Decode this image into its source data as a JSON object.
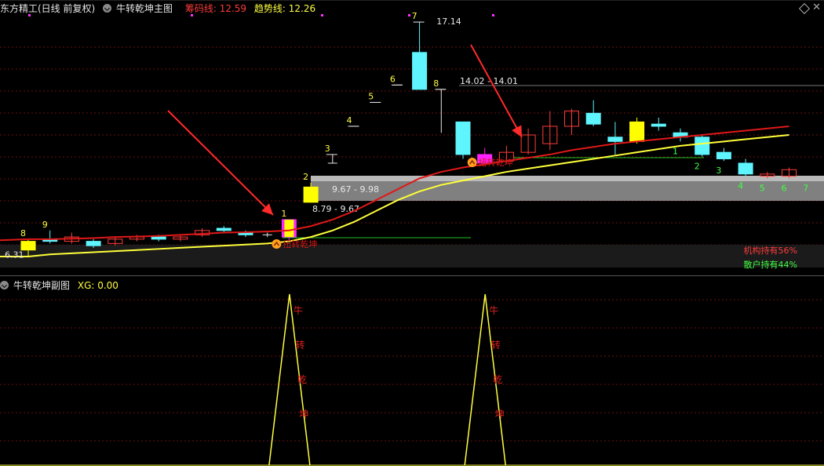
{
  "header": {
    "stock_label": "东方精工(日线 前复权)",
    "indicator_main": "牛转乾坤主图",
    "chip_line_label": "筹码线: 12.59",
    "trend_line_label": "趋势线: 12.26"
  },
  "sub_header": {
    "indicator_sub": "牛转乾坤副图",
    "xg_label": "XG: 0.00"
  },
  "annotations": {
    "price_high": "17.14",
    "price_low": "6.31",
    "range_upper": "14.02 - 14.01",
    "range_mid": "9.67 - 9.98",
    "range_low": "8.79 - 9.67",
    "signal_text": "扭转乾坤",
    "institution_hold": "机构持有56%",
    "retail_hold": "散户持有44%",
    "sub_chars": [
      "牛",
      "转",
      "乾",
      "坤"
    ]
  },
  "colors": {
    "chip_line": "#e01818",
    "trend_line": "#ffff3a",
    "up_candle": "#ff3b3b",
    "down_candle": "#5ff5ff",
    "signal_candle": "#ff22ff",
    "highlight_candle": "#ffff00"
  },
  "chart_data": {
    "type": "candlestick",
    "candles": [
      {
        "o": 7.0,
        "c": 6.6,
        "h": 7.1,
        "l": 6.3,
        "style": "yellow"
      },
      {
        "o": 7.0,
        "c": 7.1,
        "h": 7.5,
        "l": 6.9,
        "style": "down"
      },
      {
        "o": 7.0,
        "c": 7.2,
        "h": 7.4,
        "l": 6.9,
        "style": "up"
      },
      {
        "o": 7.0,
        "c": 6.8,
        "h": 7.1,
        "l": 6.7,
        "style": "down"
      },
      {
        "o": 6.9,
        "c": 7.1,
        "h": 7.2,
        "l": 6.8,
        "style": "up"
      },
      {
        "o": 7.1,
        "c": 7.2,
        "h": 7.3,
        "l": 7.0,
        "style": "up"
      },
      {
        "o": 7.2,
        "c": 7.1,
        "h": 7.3,
        "l": 7.0,
        "style": "down"
      },
      {
        "o": 7.1,
        "c": 7.2,
        "h": 7.3,
        "l": 7.0,
        "style": "up"
      },
      {
        "o": 7.3,
        "c": 7.5,
        "h": 7.6,
        "l": 7.2,
        "style": "up"
      },
      {
        "o": 7.6,
        "c": 7.5,
        "h": 7.7,
        "l": 7.4,
        "style": "down"
      },
      {
        "o": 7.4,
        "c": 7.3,
        "h": 7.5,
        "l": 7.2,
        "style": "down"
      },
      {
        "o": 7.3,
        "c": 7.3,
        "h": 7.4,
        "l": 7.2,
        "style": "flat"
      },
      {
        "o": 7.2,
        "c": 8.0,
        "h": 8.0,
        "l": 7.0,
        "style": "signal"
      },
      {
        "o": 8.8,
        "c": 9.5,
        "h": 9.7,
        "l": 8.8,
        "style": "yellow"
      },
      {
        "o": 10.6,
        "c": 10.6,
        "h": 11.0,
        "l": 10.6,
        "style": "flat"
      },
      {
        "o": 12.3,
        "c": 12.3,
        "h": 12.3,
        "l": 12.3,
        "style": "flat"
      },
      {
        "o": 13.4,
        "c": 13.4,
        "h": 13.4,
        "l": 13.4,
        "style": "flat"
      },
      {
        "o": 14.2,
        "c": 14.2,
        "h": 14.2,
        "l": 14.2,
        "style": "flat"
      },
      {
        "o": 15.7,
        "c": 14.0,
        "h": 17.1,
        "l": 14.0,
        "style": "down"
      },
      {
        "o": 14.0,
        "c": 14.0,
        "h": 14.0,
        "l": 12.0,
        "style": "flat"
      },
      {
        "o": 12.5,
        "c": 11.0,
        "h": 12.5,
        "l": 10.8,
        "style": "down"
      },
      {
        "o": 11.0,
        "c": 10.6,
        "h": 11.3,
        "l": 10.6,
        "style": "signal"
      },
      {
        "o": 10.7,
        "c": 11.1,
        "h": 11.4,
        "l": 10.6,
        "style": "up"
      },
      {
        "o": 11.1,
        "c": 11.9,
        "h": 12.2,
        "l": 11.0,
        "style": "up"
      },
      {
        "o": 11.5,
        "c": 12.3,
        "h": 13.0,
        "l": 11.2,
        "style": "up"
      },
      {
        "o": 12.3,
        "c": 13.0,
        "h": 13.1,
        "l": 11.9,
        "style": "up"
      },
      {
        "o": 12.9,
        "c": 12.4,
        "h": 13.5,
        "l": 12.3,
        "style": "down"
      },
      {
        "o": 11.8,
        "c": 11.6,
        "h": 12.5,
        "l": 11.0,
        "style": "down"
      },
      {
        "o": 11.6,
        "c": 12.5,
        "h": 12.7,
        "l": 11.5,
        "style": "yellow"
      },
      {
        "o": 12.4,
        "c": 12.3,
        "h": 12.7,
        "l": 12.1,
        "style": "down"
      },
      {
        "o": 12.0,
        "c": 11.8,
        "h": 12.2,
        "l": 11.6,
        "style": "down"
      },
      {
        "o": 11.8,
        "c": 11.0,
        "h": 11.9,
        "l": 10.9,
        "style": "down"
      },
      {
        "o": 11.1,
        "c": 10.8,
        "h": 11.3,
        "l": 10.7,
        "style": "down"
      },
      {
        "o": 10.6,
        "c": 10.1,
        "h": 10.8,
        "l": 10.0,
        "style": "down"
      },
      {
        "o": 10.1,
        "c": 10.0,
        "h": 10.2,
        "l": 9.9,
        "style": "up"
      },
      {
        "o": 10.0,
        "c": 10.3,
        "h": 10.4,
        "l": 9.9,
        "style": "up"
      }
    ],
    "chip_line": [
      7.1,
      7.1,
      7.12,
      7.15,
      7.2,
      7.22,
      7.25,
      7.3,
      7.35,
      7.4,
      7.42,
      7.45,
      7.5,
      7.7,
      8.0,
      8.4,
      8.9,
      9.4,
      9.9,
      10.2,
      10.4,
      10.55,
      10.7,
      10.85,
      11.0,
      11.2,
      11.35,
      11.5,
      11.6,
      11.7,
      11.8,
      11.9,
      12.0,
      12.1,
      12.2,
      12.3
    ],
    "trend_line": [
      6.3,
      6.4,
      6.45,
      6.5,
      6.55,
      6.6,
      6.65,
      6.7,
      6.75,
      6.8,
      6.85,
      6.9,
      7.0,
      7.2,
      7.5,
      7.9,
      8.4,
      8.9,
      9.3,
      9.6,
      9.8,
      10.0,
      10.2,
      10.35,
      10.5,
      10.65,
      10.8,
      10.95,
      11.1,
      11.25,
      11.4,
      11.5,
      11.6,
      11.7,
      11.8,
      11.9
    ],
    "count_labels": [
      {
        "i": 0,
        "t": "8",
        "color": "#ffff40"
      },
      {
        "i": 1,
        "t": "9",
        "color": "#ffff40"
      },
      {
        "i": 12,
        "t": "1",
        "color": "#ffff40"
      },
      {
        "i": 13,
        "t": "2",
        "color": "#ffff40"
      },
      {
        "i": 14,
        "t": "3",
        "color": "#ffff40"
      },
      {
        "i": 15,
        "t": "4",
        "color": "#ffff40"
      },
      {
        "i": 16,
        "t": "5",
        "color": "#ffff40"
      },
      {
        "i": 17,
        "t": "6",
        "color": "#ffff40"
      },
      {
        "i": 18,
        "t": "7",
        "color": "#ffff40"
      },
      {
        "i": 19,
        "t": "8",
        "color": "#ffff40"
      },
      {
        "i": 30,
        "t": "1",
        "color": "#40ff40"
      },
      {
        "i": 31,
        "t": "2",
        "color": "#40ff40"
      },
      {
        "i": 32,
        "t": "3",
        "color": "#40ff40"
      },
      {
        "i": 33,
        "t": "4",
        "color": "#40ff40"
      },
      {
        "i": 34,
        "t": "5",
        "color": "#40ff40"
      },
      {
        "i": 35,
        "t": "6",
        "color": "#40ff40"
      },
      {
        "i": 36,
        "t": "7",
        "color": "#40ff40"
      }
    ],
    "sub_signal_peaks": [
      12,
      21
    ],
    "sub_signal_value": [
      0,
      1
    ]
  }
}
